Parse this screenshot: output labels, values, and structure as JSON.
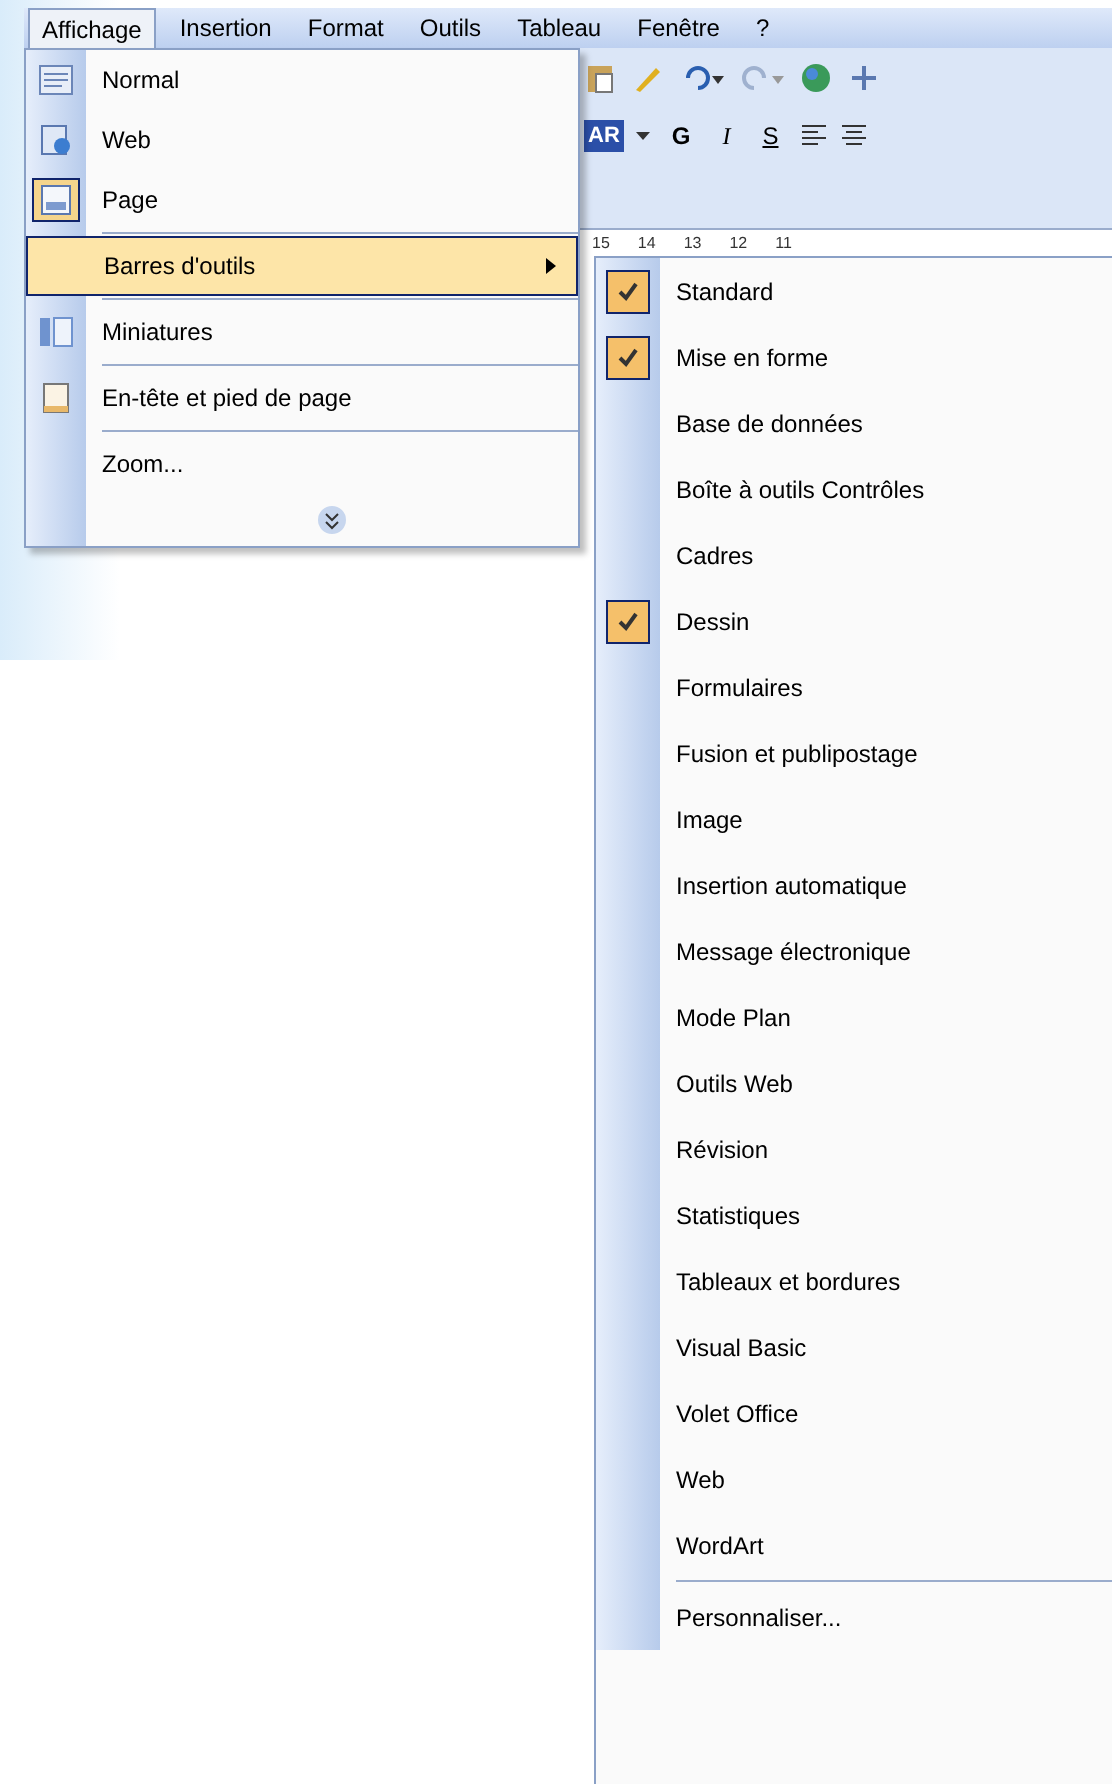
{
  "menu_bar": [
    {
      "label": "Affichage",
      "selected": true
    },
    {
      "label": "Insertion",
      "selected": false
    },
    {
      "label": "Format",
      "selected": false
    },
    {
      "label": "Outils",
      "selected": false
    },
    {
      "label": "Tableau",
      "selected": false
    },
    {
      "label": "Fenêtre",
      "selected": false
    },
    {
      "label": "?",
      "selected": false
    }
  ],
  "toolbar": {
    "style_box": "AR",
    "format_buttons": [
      "G",
      "I",
      "S"
    ],
    "ruler_labels": [
      "15",
      "14",
      "13",
      "12",
      "11"
    ]
  },
  "view_menu": [
    {
      "label": "Normal",
      "kind": "item",
      "checked": false,
      "selected": false
    },
    {
      "label": "Web",
      "kind": "item",
      "checked": false,
      "selected": false
    },
    {
      "label": "Page",
      "kind": "item",
      "checked": true,
      "selected": false
    },
    {
      "kind": "separator"
    },
    {
      "label": "Barres d'outils",
      "kind": "submenu",
      "selected": true
    },
    {
      "kind": "separator"
    },
    {
      "label": "Miniatures",
      "kind": "item",
      "checked": false,
      "selected": false
    },
    {
      "kind": "separator"
    },
    {
      "label": "En-tête et pied de page",
      "kind": "item",
      "checked": false,
      "selected": false
    },
    {
      "kind": "separator"
    },
    {
      "label": "Zoom...",
      "kind": "plain",
      "selected": false
    },
    {
      "kind": "expand"
    }
  ],
  "toolbars_submenu": [
    {
      "label": "Standard",
      "kind": "item",
      "checked": true
    },
    {
      "label": "Mise en forme",
      "kind": "item",
      "checked": true
    },
    {
      "label": "Base de données",
      "kind": "item",
      "checked": false
    },
    {
      "label": "Boîte à outils Contrôles",
      "kind": "item",
      "checked": false
    },
    {
      "label": "Cadres",
      "kind": "item",
      "checked": false
    },
    {
      "label": "Dessin",
      "kind": "item",
      "checked": true
    },
    {
      "label": "Formulaires",
      "kind": "item",
      "checked": false
    },
    {
      "label": "Fusion et publipostage",
      "kind": "item",
      "checked": false
    },
    {
      "label": "Image",
      "kind": "item",
      "checked": false
    },
    {
      "label": "Insertion automatique",
      "kind": "item",
      "checked": false
    },
    {
      "label": "Message électronique",
      "kind": "item",
      "checked": false
    },
    {
      "label": "Mode Plan",
      "kind": "item",
      "checked": false
    },
    {
      "label": "Outils Web",
      "kind": "item",
      "checked": false
    },
    {
      "label": "Révision",
      "kind": "item",
      "checked": false
    },
    {
      "label": "Statistiques",
      "kind": "item",
      "checked": false
    },
    {
      "label": "Tableaux et bordures",
      "kind": "item",
      "checked": false
    },
    {
      "label": "Visual Basic",
      "kind": "item",
      "checked": false
    },
    {
      "label": "Volet Office",
      "kind": "item",
      "checked": false
    },
    {
      "label": "Web",
      "kind": "item",
      "checked": false
    },
    {
      "label": "WordArt",
      "kind": "item",
      "checked": false
    },
    {
      "kind": "separator"
    },
    {
      "label": "Personnaliser...",
      "kind": "item",
      "checked": false
    }
  ]
}
